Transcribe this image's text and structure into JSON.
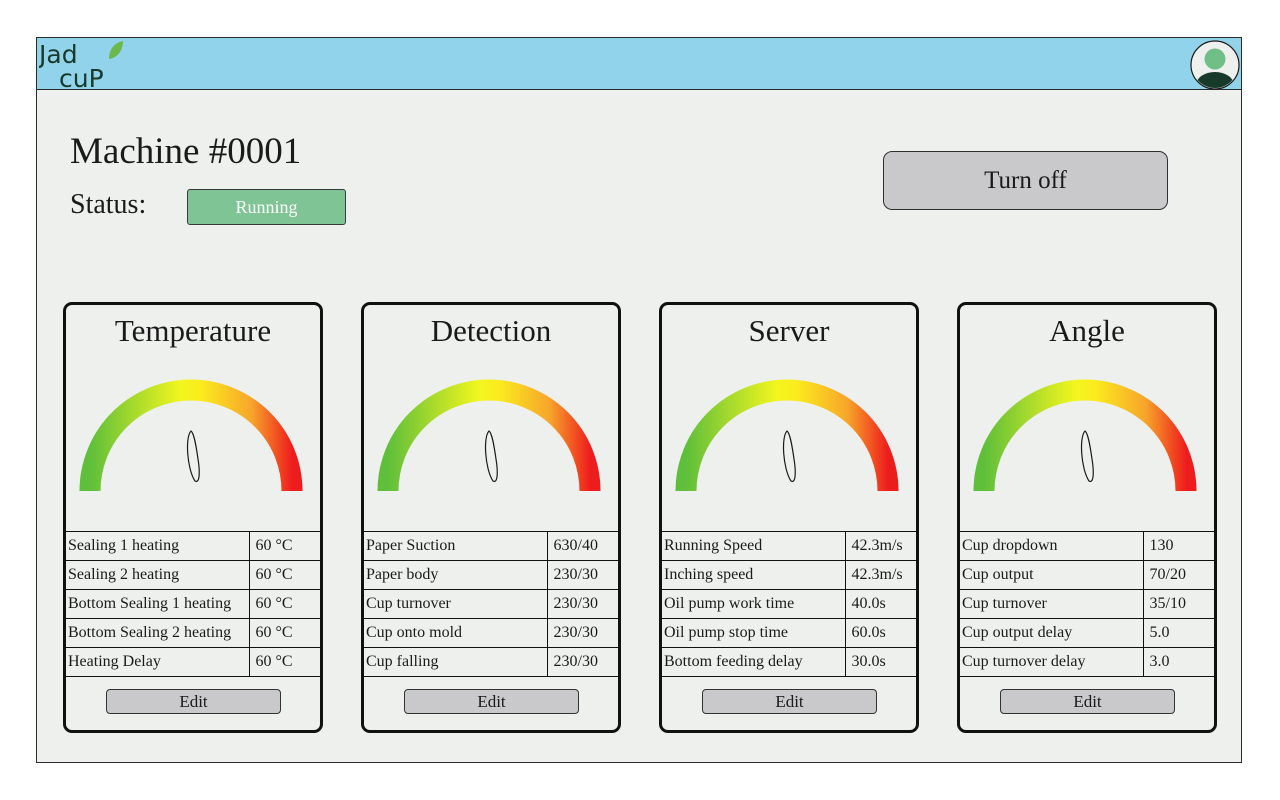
{
  "brand": {
    "logo_text_top": "Jad",
    "logo_text_bottom": "cuP"
  },
  "user": {
    "avatar_icon": "user-avatar-icon"
  },
  "machine": {
    "title": "Machine #0001",
    "status_label": "Status:",
    "status_value": "Running",
    "turn_off_label": "Turn off"
  },
  "colors": {
    "header_bg": "#90d3ea",
    "status_green": "#7ec494",
    "gauge_low": "#5fbf3a",
    "gauge_mid": "#f5f51e",
    "gauge_high": "#ee1d1d"
  },
  "cards": [
    {
      "title": "Temperature",
      "edit_label": "Edit",
      "rows": [
        {
          "label": "Sealing 1 heating",
          "value": "60 °C"
        },
        {
          "label": "Sealing 2 heating",
          "value": "60 °C"
        },
        {
          "label": "Bottom Sealing 1 heating",
          "value": "60 °C"
        },
        {
          "label": "Bottom Sealing 2 heating",
          "value": "60 °C"
        },
        {
          "label": "Heating Delay",
          "value": "60 °C"
        }
      ]
    },
    {
      "title": "Detection",
      "edit_label": "Edit",
      "rows": [
        {
          "label": "Paper Suction",
          "value": "630/40"
        },
        {
          "label": "Paper body",
          "value": "230/30"
        },
        {
          "label": "Cup turnover",
          "value": "230/30"
        },
        {
          "label": "Cup onto mold",
          "value": "230/30"
        },
        {
          "label": "Cup falling",
          "value": "230/30"
        }
      ]
    },
    {
      "title": "Server",
      "edit_label": "Edit",
      "rows": [
        {
          "label": "Running Speed",
          "value": "42.3m/s"
        },
        {
          "label": "Inching speed",
          "value": "42.3m/s"
        },
        {
          "label": "Oil pump work time",
          "value": "40.0s"
        },
        {
          "label": "Oil pump stop time",
          "value": "60.0s"
        },
        {
          "label": "Bottom feeding delay",
          "value": "30.0s"
        }
      ]
    },
    {
      "title": "Angle",
      "edit_label": "Edit",
      "rows": [
        {
          "label": "Cup dropdown",
          "value": "130"
        },
        {
          "label": "Cup output",
          "value": "70/20"
        },
        {
          "label": "Cup turnover",
          "value": "35/10"
        },
        {
          "label": "Cup output delay",
          "value": "5.0"
        },
        {
          "label": "Cup turnover delay",
          "value": "3.0"
        }
      ]
    }
  ]
}
